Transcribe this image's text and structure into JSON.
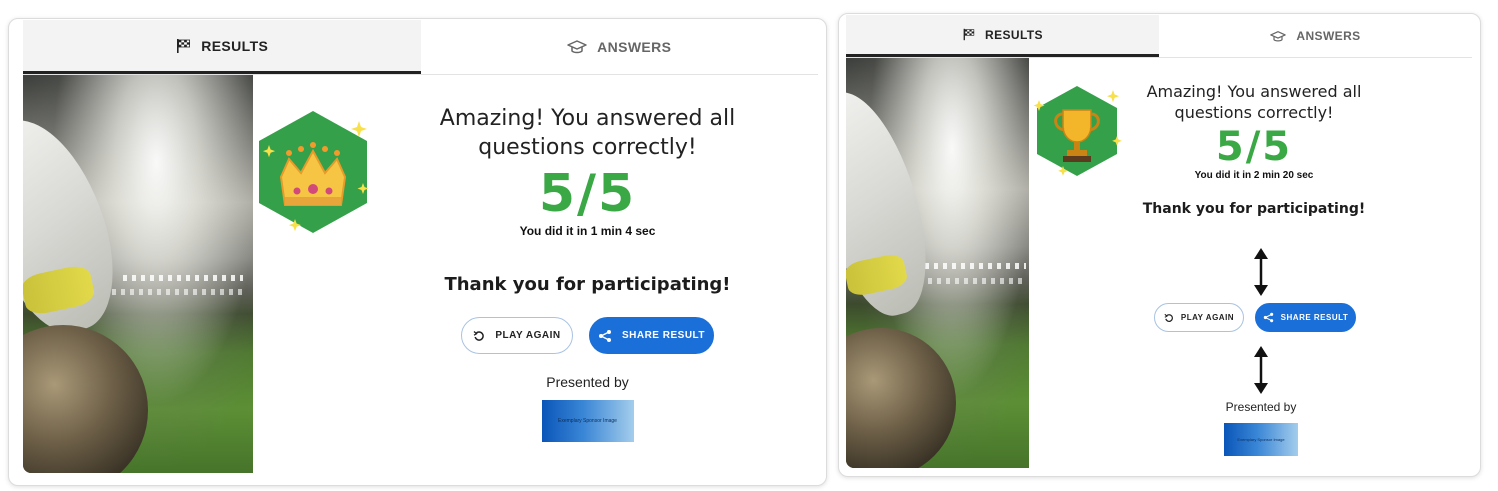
{
  "left": {
    "tabs": {
      "results": "RESULTS",
      "answers": "ANSWERS"
    },
    "headline": "Amazing! You answered all questions correctly!",
    "score": "5/5",
    "time": "You did it in 1 min 4 sec",
    "thanks": "Thank you for participating!",
    "buttons": {
      "play_again": "PLAY AGAIN",
      "share": "SHARE RESULT"
    },
    "presented_by": "Presented by",
    "sponsor_text": "Exemplary Sponsor Image",
    "badge_icon": "crown-icon"
  },
  "right": {
    "tabs": {
      "results": "RESULTS",
      "answers": "ANSWERS"
    },
    "headline": "Amazing! You answered all questions correctly!",
    "score": "5/5",
    "time": "You did it in 2 min 20 sec",
    "thanks": "Thank you for participating!",
    "buttons": {
      "play_again": "PLAY AGAIN",
      "share": "SHARE RESULT"
    },
    "presented_by": "Presented by",
    "sponsor_text": "Exemplary Sponsor Image",
    "badge_icon": "trophy-icon"
  },
  "colors": {
    "score_green": "#3aa845",
    "badge_green": "#35a04a",
    "share_blue": "#1b6fd8"
  }
}
